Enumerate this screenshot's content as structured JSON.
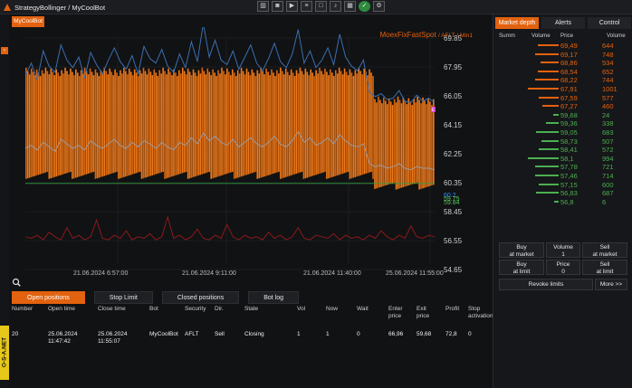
{
  "window": {
    "title": "StrategyBollinger / MyCoolBot"
  },
  "toolbar": {
    "icons": [
      "chart-icon",
      "camera-icon",
      "video-icon",
      "layers-icon",
      "square-icon",
      "bell-icon",
      "grid-icon",
      "ok-icon",
      "settings-icon"
    ]
  },
  "bot_button": {
    "label": "MyCoolBot"
  },
  "chart": {
    "title": "MoexFixFastSpot",
    "subtitle": "/ AFLT / Min1",
    "price_markers": [
      {
        "text": "60.2",
        "color": "#2f8fff"
      },
      {
        "text": "59.75",
        "color": "#58c25a"
      },
      {
        "text": "59.84",
        "color": "#58c25a"
      }
    ],
    "right_marker": "E"
  },
  "chart_data": {
    "type": "line",
    "y_ticks": [
      "69.85",
      "67.95",
      "66.05",
      "64.15",
      "62.25",
      "60.35",
      "58.45",
      "56.55",
      "54.65"
    ],
    "x_ticks": [
      "21.06.2024 6:57:00",
      "21.06.2024 9:11:00",
      "21.06.2024 11:40:00",
      "25.06.2024 11:55:00"
    ],
    "ylim": [
      54.65,
      69.85
    ],
    "grid": true,
    "series": [
      {
        "color": "#3b6fb0",
        "values": [
          67.4,
          68.2,
          67.1,
          69.0,
          68.0,
          67.6,
          69.4,
          68.4,
          67.9,
          68.6,
          67.2,
          68.9,
          68.1,
          67.5,
          68.4,
          69.2,
          68.3,
          67.8,
          68.7,
          67.5,
          69.3,
          68.5,
          68.2,
          69.1,
          68.0,
          67.6,
          68.8,
          67.9,
          69.6,
          68.3,
          70.8,
          68.6,
          69.7,
          68.4,
          68.1,
          69.0,
          67.8,
          68.6,
          69.4,
          68.2,
          67.7,
          68.5,
          69.5,
          68.3,
          67.9,
          68.8,
          70.4,
          68.2,
          69.0,
          67.9,
          68.4,
          69.2,
          68.1,
          70.1,
          68.6,
          68.0,
          67.7,
          68.4,
          66.3,
          66.0,
          66.2,
          65.8,
          65.9,
          66.4,
          65.7,
          65.6,
          66.1,
          65.7,
          65.9,
          65.6
        ]
      },
      {
        "color": "#9a9aa0",
        "values": [
          62.6,
          62.8,
          62.5,
          63.0,
          62.7,
          62.4,
          63.2,
          62.9,
          62.6,
          62.8,
          62.5,
          63.1,
          62.8,
          62.6,
          62.9,
          63.2,
          62.8,
          62.6,
          63.0,
          62.7,
          63.1,
          62.9,
          62.6,
          63.0,
          62.7,
          62.5,
          63.0,
          62.8,
          63.3,
          62.9,
          63.6,
          63.1,
          63.4,
          63.0,
          62.8,
          63.2,
          62.7,
          63.0,
          63.3,
          62.9,
          62.7,
          63.0,
          63.4,
          62.9,
          62.7,
          63.1,
          63.7,
          63.0,
          63.3,
          62.8,
          63.0,
          63.3,
          62.9,
          63.5,
          63.1,
          62.8,
          62.7,
          62.9,
          61.6,
          61.4,
          61.5,
          61.3,
          61.4,
          61.6,
          61.3,
          61.2,
          61.4,
          61.3,
          61.3,
          61.2
        ]
      },
      {
        "color": "#8c1a1a",
        "values": [
          56.8,
          56.7,
          56.9,
          56.6,
          57.1,
          56.8,
          56.6,
          57.4,
          56.7,
          56.9,
          56.6,
          56.8,
          57.9,
          56.7,
          56.6,
          56.9,
          56.7,
          57.2,
          56.6,
          56.8,
          56.7,
          57.0,
          56.6,
          56.8,
          58.1,
          56.7,
          56.9,
          56.6,
          56.8,
          57.3,
          56.7,
          56.6,
          56.9,
          56.7,
          57.6,
          56.8,
          56.6,
          56.9,
          56.7,
          56.8,
          56.6,
          57.1,
          56.7,
          56.9,
          56.6,
          56.8,
          57.4,
          56.7,
          56.6,
          56.9,
          56.8,
          56.7,
          57.0,
          56.6,
          56.9,
          56.7,
          56.8,
          56.6,
          56.9,
          56.7,
          57.2,
          56.8,
          56.6,
          56.9,
          56.7,
          57.5,
          56.8,
          56.7,
          56.9,
          56.8
        ]
      },
      {
        "color": "#2f9d3a",
        "values": [
          60.3,
          60.3,
          60.3,
          60.3,
          60.3,
          60.3,
          60.3,
          60.3,
          60.3,
          60.3,
          60.3,
          60.3,
          60.3,
          60.3,
          60.3,
          60.3,
          60.3,
          60.3,
          60.3,
          60.3,
          60.3,
          60.3,
          60.3,
          60.3,
          60.3,
          60.3,
          60.3,
          60.3,
          60.3,
          60.3,
          60.3,
          60.3,
          60.3,
          60.3,
          60.3,
          60.3,
          60.3,
          60.3,
          60.3,
          60.3,
          60.3,
          60.3,
          60.3,
          60.3,
          60.3,
          60.3,
          60.3,
          60.3,
          60.3,
          60.3,
          60.3,
          60.3,
          60.3,
          60.3,
          60.3,
          60.3,
          60.3,
          60.3,
          60.3,
          60.3,
          60.3,
          60.3,
          60.3,
          60.3,
          60.3,
          60.3,
          60.3,
          60.3,
          60.3,
          60.3
        ]
      }
    ],
    "candle_bands": {
      "color": "#f07a1a",
      "high": 67.9,
      "low": 60.6,
      "high_after_break": 66.0,
      "low_after_break": 59.9,
      "break_fraction": 0.85
    }
  },
  "bottom_tabs": [
    "Open positions",
    "Stop Limit",
    "Closed positions",
    "Bot log"
  ],
  "positions_table": {
    "headers": [
      "Number",
      "Open time",
      "Close time",
      "Bot",
      "Security",
      "Dir.",
      "State",
      "Vol",
      "Now",
      "Wait",
      "Enter\nprice",
      "Exit\nprice",
      "Profit",
      "Stop\nactivation",
      "Stop\nprice",
      "Profit\nActivation",
      "Profit\nPrice",
      "Signal\nType\nOpen",
      "Signal\nType\nClose"
    ],
    "rows": [
      [
        "20",
        "25.06.2024\n11:47:42",
        "25.06.2024\n11:55:07",
        "MyCoolBot",
        "AFLT",
        "Sell",
        "Closing",
        "1",
        "1",
        "0",
        "66,96",
        "59,68",
        "72,8",
        "0",
        "0",
        "0",
        "0",
        "",
        ""
      ]
    ]
  },
  "side_tab": "O-S-A.NET",
  "right_panel": {
    "tabs": [
      "Market depth",
      "Alerts",
      "Control"
    ],
    "depth_headers": [
      "Summ",
      "Volume",
      "Price",
      "Volume"
    ],
    "asks": [
      {
        "price": "69,49",
        "volume": "644",
        "bar": 0.24
      },
      {
        "price": "69,17",
        "volume": "748",
        "bar": 0.28
      },
      {
        "price": "68,86",
        "volume": "534",
        "bar": 0.2
      },
      {
        "price": "68,54",
        "volume": "652",
        "bar": 0.24
      },
      {
        "price": "68,22",
        "volume": "744",
        "bar": 0.28
      },
      {
        "price": "67,91",
        "volume": "1001",
        "bar": 0.38
      },
      {
        "price": "67,59",
        "volume": "577",
        "bar": 0.22
      },
      {
        "price": "67,27",
        "volume": "460",
        "bar": 0.18
      }
    ],
    "bids": [
      {
        "price": "59,68",
        "volume": "24",
        "bar": 0.02
      },
      {
        "price": "59,36",
        "volume": "338",
        "bar": 0.12
      },
      {
        "price": "59,05",
        "volume": "683",
        "bar": 0.26
      },
      {
        "price": "58,73",
        "volume": "507",
        "bar": 0.19
      },
      {
        "price": "58,41",
        "volume": "572",
        "bar": 0.22
      },
      {
        "price": "58,1",
        "volume": "994",
        "bar": 0.37
      },
      {
        "price": "57,78",
        "volume": "721",
        "bar": 0.27
      },
      {
        "price": "57,46",
        "volume": "714",
        "bar": 0.27
      },
      {
        "price": "57,15",
        "volume": "600",
        "bar": 0.23
      },
      {
        "price": "56,83",
        "volume": "687",
        "bar": 0.26
      },
      {
        "price": "56,8",
        "volume": "6",
        "bar": 0.01
      }
    ],
    "buy_market": "Buy\nat market",
    "volume_label": "Volume",
    "volume_value": "1",
    "sell_market": "Sell\nat market",
    "buy_limit": "Buy\nat limit",
    "price_label": "Price",
    "price_value": "0",
    "sell_limit": "Sell\nat limit",
    "revoke": "Revoke limits",
    "more": "More >>"
  },
  "colors": {
    "accent": "#e2620f",
    "ask": "#e2620f",
    "bid": "#4caf50"
  }
}
